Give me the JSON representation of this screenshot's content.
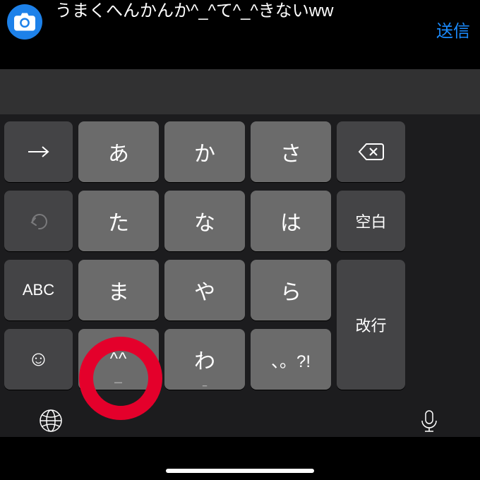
{
  "composer": {
    "text": "うまくへんかんか^_^て^_^きないww",
    "send": "送信"
  },
  "keys": {
    "abc": "ABC",
    "a": "あ",
    "ka": "か",
    "sa": "さ",
    "ta": "た",
    "na": "な",
    "ha": "は",
    "space": "空白",
    "ma": "ま",
    "ya": "や",
    "ra": "ら",
    "enter": "改行",
    "kaomoji": "^^",
    "kaomoji_sub": "—",
    "wa": "わ",
    "wa_sub": "_",
    "punct": "、。?!"
  }
}
